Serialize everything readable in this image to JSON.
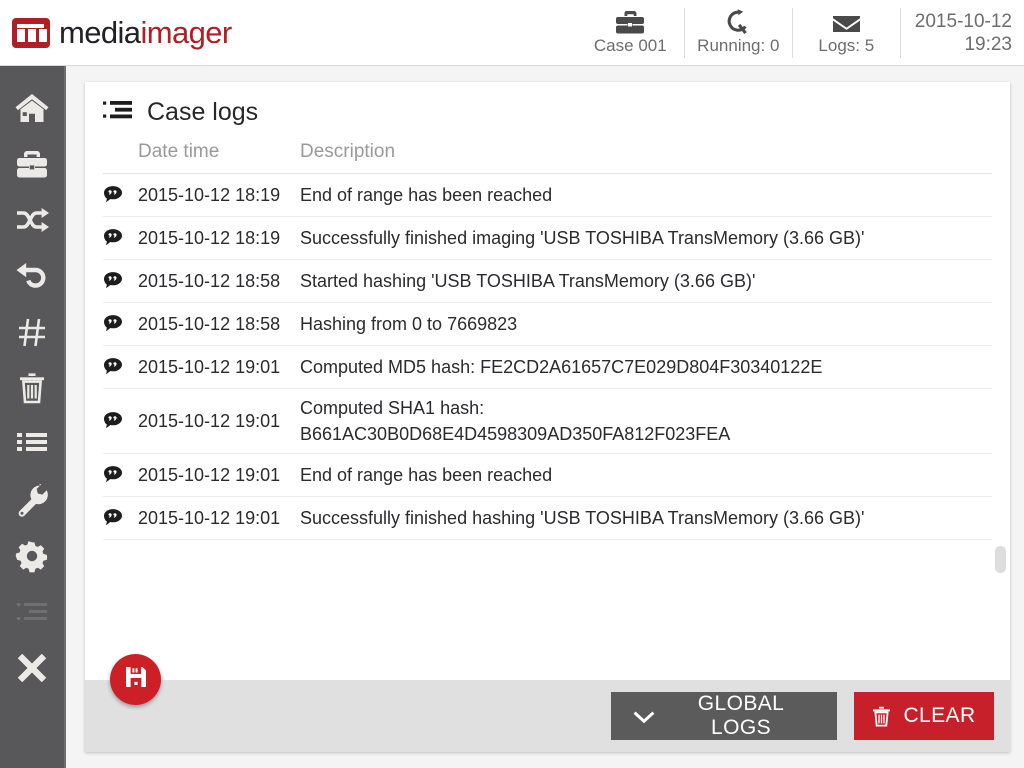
{
  "brand": {
    "text_dark": "media",
    "text_red": "imager",
    "logo_icon": "mediaimager-logo-icon",
    "logo_color": "#b01f24"
  },
  "header": {
    "status": [
      {
        "icon": "briefcase-icon",
        "label": "Case 001"
      },
      {
        "icon": "refresh-rotate-icon",
        "label": "Running: 0"
      },
      {
        "icon": "envelope-icon",
        "label": "Logs: 5"
      }
    ],
    "clock": {
      "date": "2015-10-12",
      "time": "19:23"
    }
  },
  "sidebar": {
    "items": [
      {
        "icon": "home-icon",
        "name": "sidebar-item-home"
      },
      {
        "icon": "briefcase-icon",
        "name": "sidebar-item-cases"
      },
      {
        "icon": "shuffle-icon",
        "name": "sidebar-item-imaging"
      },
      {
        "icon": "undo-icon",
        "name": "sidebar-item-restore"
      },
      {
        "icon": "hash-icon",
        "name": "sidebar-item-hashing"
      },
      {
        "icon": "trash-icon",
        "name": "sidebar-item-wipe"
      },
      {
        "icon": "list-icon",
        "name": "sidebar-item-devices"
      },
      {
        "icon": "wrench-icon",
        "name": "sidebar-item-tools"
      },
      {
        "icon": "gear-icon",
        "name": "sidebar-item-settings"
      },
      {
        "icon": "case-logs-icon",
        "name": "sidebar-item-logs"
      },
      {
        "icon": "close-x-icon",
        "name": "sidebar-item-exit"
      }
    ]
  },
  "panel": {
    "icon": "case-logs-icon",
    "title": "Case logs",
    "columns": {
      "date": "Date time",
      "description": "Description"
    },
    "row_icon": "comment-quote-icon",
    "rows": [
      {
        "datetime": "2015-10-12 18:19",
        "description": "End of range has been reached"
      },
      {
        "datetime": "2015-10-12 18:19",
        "description": "Successfully finished imaging 'USB TOSHIBA  TransMemory (3.66 GB)'"
      },
      {
        "datetime": "2015-10-12 18:58",
        "description": "Started hashing 'USB TOSHIBA  TransMemory (3.66 GB)'"
      },
      {
        "datetime": "2015-10-12 18:58",
        "description": "Hashing from 0 to 7669823"
      },
      {
        "datetime": "2015-10-12 19:01",
        "description": "Computed MD5 hash: FE2CD2A61657C7E029D804F30340122E"
      },
      {
        "datetime": "2015-10-12 19:01",
        "description": "Computed SHA1 hash:\nB661AC30B0D68E4D4598309AD350FA812F023FEA"
      },
      {
        "datetime": "2015-10-12 19:01",
        "description": "End of range has been reached"
      },
      {
        "datetime": "2015-10-12 19:01",
        "description": "Successfully finished hashing 'USB TOSHIBA  TransMemory (3.66 GB)'"
      }
    ]
  },
  "footer": {
    "save_fab_icon": "save-floppy-icon",
    "global_logs": {
      "label": "GLOBAL LOGS",
      "icon": "chevron-down-icon",
      "color": "#5b5b5b"
    },
    "clear": {
      "label": "CLEAR",
      "icon": "trash-icon",
      "color": "#c8202a"
    }
  }
}
